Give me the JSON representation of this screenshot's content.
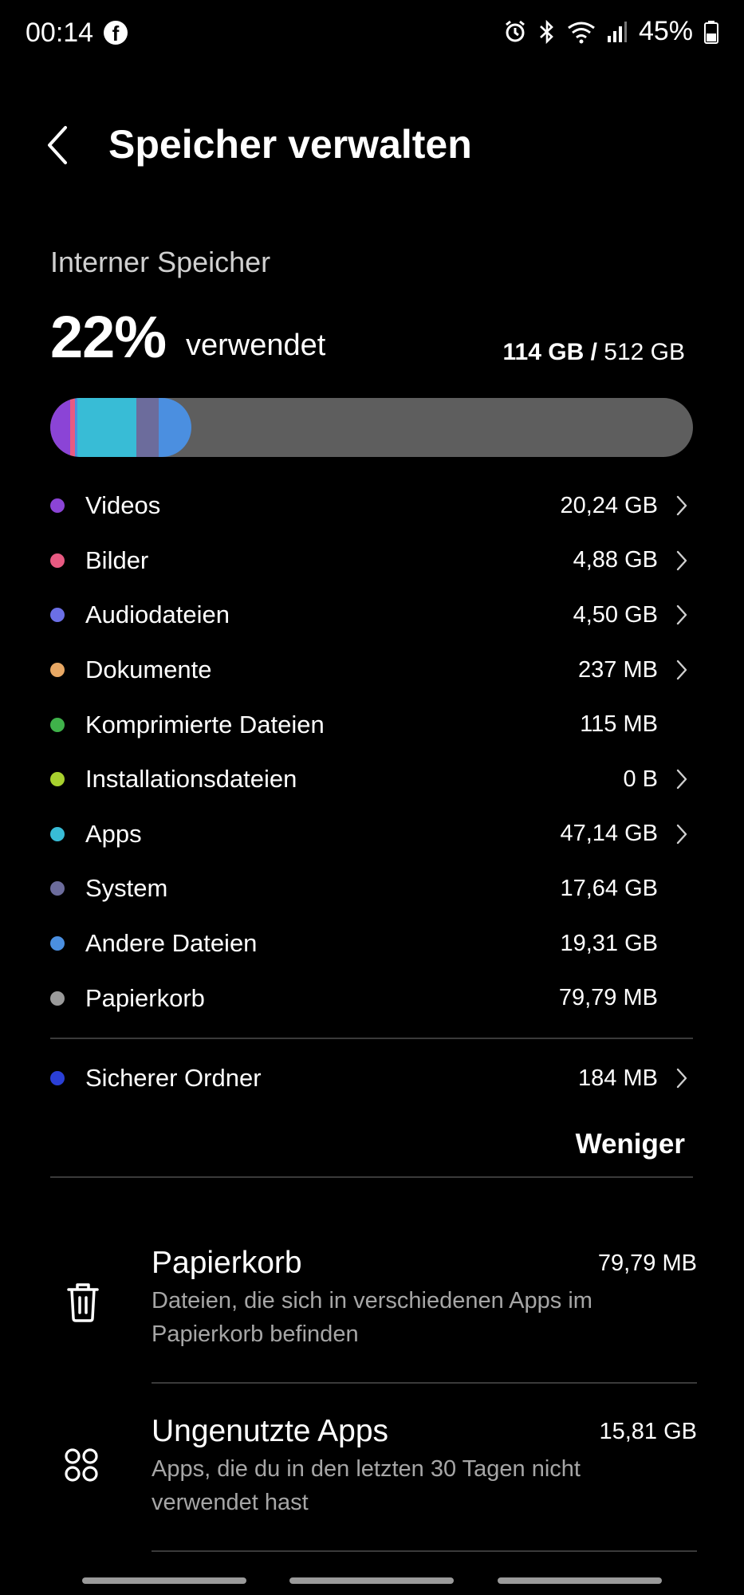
{
  "status_bar": {
    "time": "00:14",
    "battery_percent": "45%",
    "icons": [
      "facebook-icon",
      "alarm-icon",
      "bluetooth-icon",
      "wifi-icon",
      "signal-icon",
      "battery-icon"
    ]
  },
  "header": {
    "title": "Speicher verwalten",
    "back_icon": "chevron-left-icon"
  },
  "storage": {
    "section_label": "Interner Speicher",
    "percent_used": "22%",
    "used_word": "verwendet",
    "used_amount": "114 GB /",
    "total_amount": "512 GB",
    "bar_fill_fraction": 0.22,
    "categories": [
      {
        "label": "Videos",
        "size": "20,24 GB",
        "color": "#8b44d6",
        "chevron": true
      },
      {
        "label": "Bilder",
        "size": "4,88 GB",
        "color": "#e85a82",
        "chevron": true
      },
      {
        "label": "Audiodateien",
        "size": "4,50 GB",
        "color": "#6b6fe6",
        "chevron": true
      },
      {
        "label": "Dokumente",
        "size": "237 MB",
        "color": "#e8a864",
        "chevron": true
      },
      {
        "label": "Komprimierte Dateien",
        "size": "115 MB",
        "color": "#3fb24a",
        "chevron": false
      },
      {
        "label": "Installationsdateien",
        "size": "0 B",
        "color": "#a8d12e",
        "chevron": true
      },
      {
        "label": "Apps",
        "size": "47,14 GB",
        "color": "#38bcd6",
        "chevron": true
      },
      {
        "label": "System",
        "size": "17,64 GB",
        "color": "#6c6c9c",
        "chevron": false
      },
      {
        "label": "Andere Dateien",
        "size": "19,31 GB",
        "color": "#4b8fe0",
        "chevron": false
      },
      {
        "label": "Papierkorb",
        "size": "79,79 MB",
        "color": "#9a9a9a",
        "chevron": false
      }
    ],
    "secure_folder": {
      "label": "Sicherer Ordner",
      "size": "184 MB",
      "color": "#2a3fd6",
      "chevron": true
    },
    "less_label": "Weniger"
  },
  "cards": [
    {
      "icon": "trash-icon",
      "title": "Papierkorb",
      "size": "79,79 MB",
      "desc": "Dateien, die sich in verschiedenen Apps im Papierkorb befinden"
    },
    {
      "icon": "apps-grid-icon",
      "title": "Ungenutzte Apps",
      "size": "15,81 GB",
      "desc": "Apps, die du in den letzten 30 Tagen nicht verwendet hast"
    }
  ]
}
